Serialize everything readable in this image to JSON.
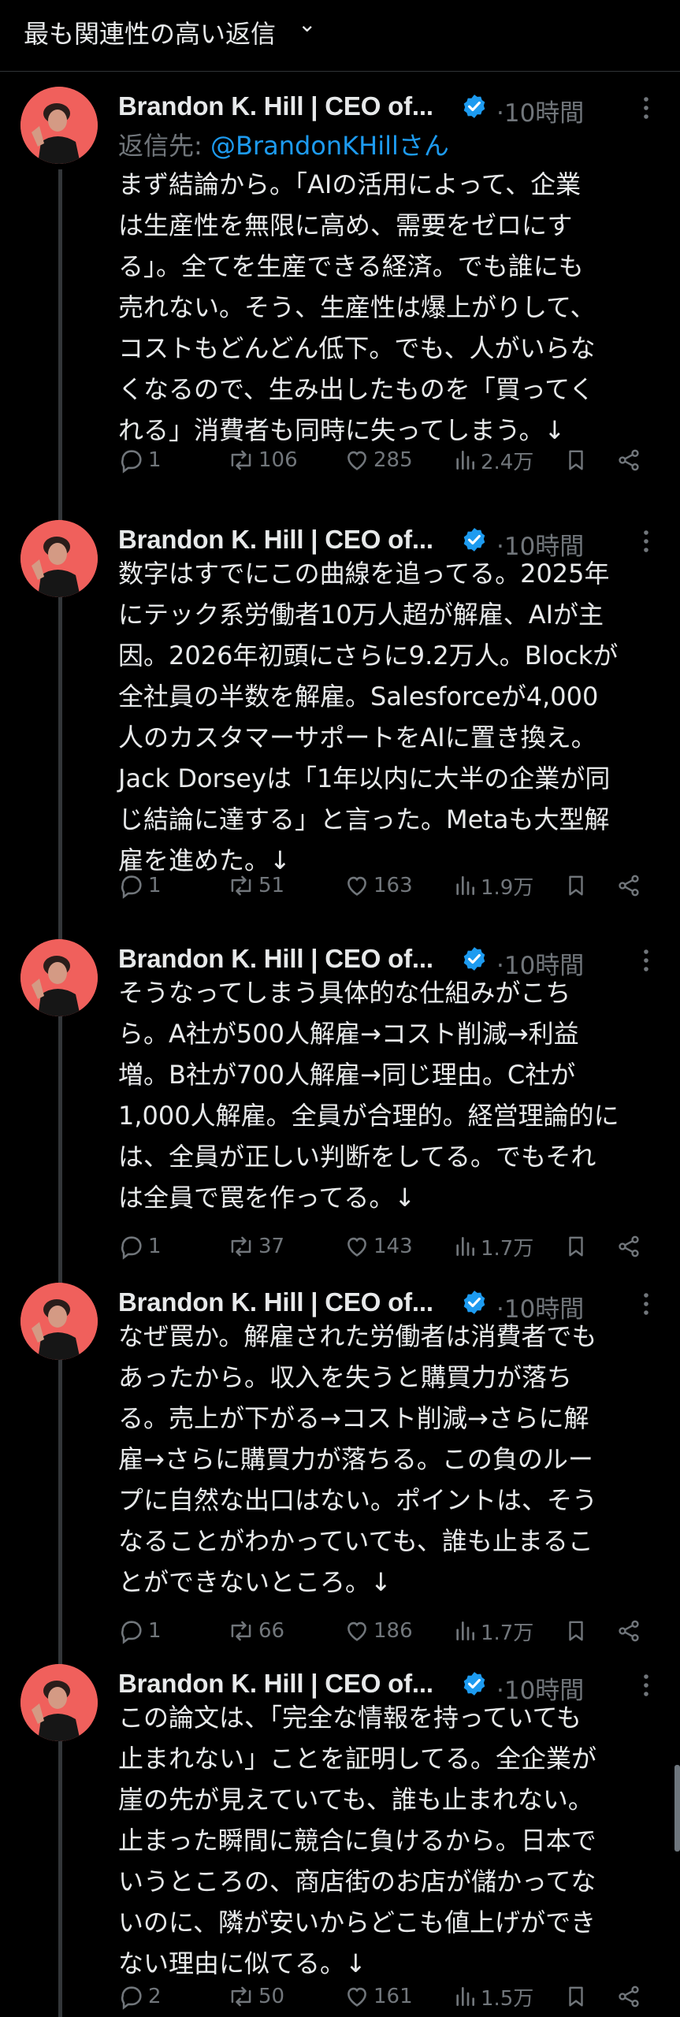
{
  "top_bar": {
    "sort_label": "最も関連性の高い返信",
    "chevron": "⌄"
  },
  "author": {
    "name": "Brandon K. Hill | CEO of...",
    "time": "·10時間"
  },
  "reply_to": {
    "prefix": "返信先: ",
    "handle": "@BrandonKHillさん"
  },
  "colors": {
    "background": "#000000",
    "text": "#e7e9ea",
    "secondary": "#71767b",
    "accent": "#1d9bf0",
    "avatar": "#f0605c"
  },
  "icons": [
    "verified-badge-icon",
    "more-icon",
    "reply-icon",
    "retweet-icon",
    "like-icon",
    "views-icon",
    "bookmark-icon",
    "share-icon"
  ],
  "tweets": [
    {
      "text": "まず結論から。「AIの活用によって、企業\nは生産性を無限に高め、需要をゼロにす\nる」。全てを生産できる経済。でも誰にも\n売れない。そう、生産性は爆上がりして、\nコストもどんどん低下。でも、人がいらな\nくなるので、生み出したものを「買ってく\nれる」消費者も同時に失ってしまう。↓",
      "replies": "1",
      "retweets": "106",
      "likes": "285",
      "views": "2.4万"
    },
    {
      "text": "数字はすでにこの曲線を追ってる。2025年\nにテック系労働者10万人超が解雇、AIが主\n因。2026年初頭にさらに9.2万人。Blockが\n全社員の半数を解雇。Salesforceが4,000\n人のカスタマーサポートをAIに置き換え。\nJack Dorseyは「1年以内に大半の企業が同\nじ結論に達する」と言った。Metaも大型解\n雇を進めた。↓",
      "replies": "1",
      "retweets": "51",
      "likes": "163",
      "views": "1.9万"
    },
    {
      "text": "そうなってしまう具体的な仕組みがこち\nら。A社が500人解雇→コスト削減→利益\n増。B社が700人解雇→同じ理由。C社が\n1,000人解雇。全員が合理的。経営理論的に\nは、全員が正しい判断をしてる。でもそれ\nは全員で罠を作ってる。↓",
      "replies": "1",
      "retweets": "37",
      "likes": "143",
      "views": "1.7万"
    },
    {
      "text": "なぜ罠か。解雇された労働者は消費者でも\nあったから。収入を失うと購買力が落ち\nる。売上が下がる→コスト削減→さらに解\n雇→さらに購買力が落ちる。この負のルー\nプに自然な出口はない。ポイントは、そう\nなることがわかっていても、誰も止まるこ\nとができないところ。↓",
      "replies": "1",
      "retweets": "66",
      "likes": "186",
      "views": "1.7万"
    },
    {
      "text": "この論文は、「完全な情報を持っていても\n止まれない」ことを証明してる。全企業が\n崖の先が見えていても、誰も止まれない。\n止まった瞬間に競合に負けるから。日本で\nいうところの、商店街のお店が儲かってな\nいのに、隣が安いからどこも値上げができ\nない理由に似てる。↓",
      "replies": "2",
      "retweets": "50",
      "likes": "161",
      "views": "1.5万"
    }
  ]
}
